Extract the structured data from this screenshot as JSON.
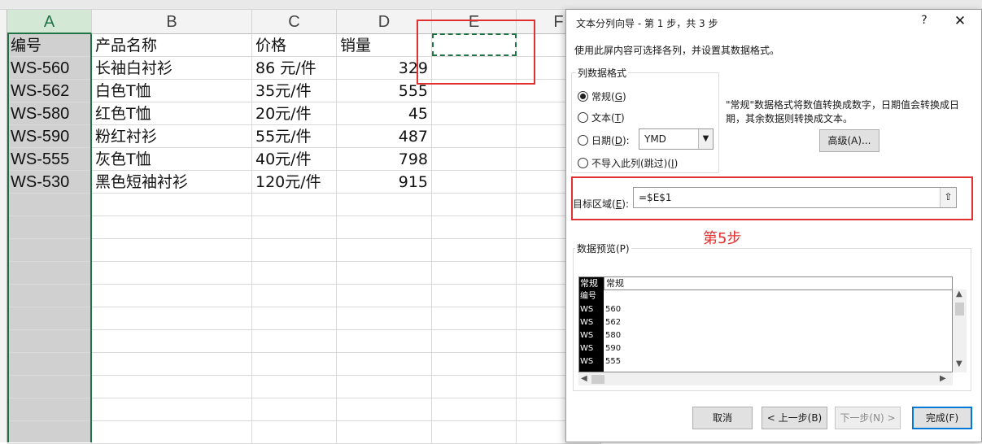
{
  "sheet": {
    "columns": [
      "A",
      "B",
      "C",
      "D",
      "E",
      "F"
    ],
    "rows": [
      [
        "编号",
        "产品名称",
        "价格",
        "销量"
      ],
      [
        "WS-560",
        "长袖白衬衫",
        "86 元/件",
        "329"
      ],
      [
        "WS-562",
        "白色T恤",
        "35元/件",
        "555"
      ],
      [
        "WS-580",
        "红色T恤",
        "20元/件",
        "45"
      ],
      [
        "WS-590",
        "粉红衬衫",
        "55元/件",
        "487"
      ],
      [
        "WS-555",
        "灰色T恤",
        "40元/件",
        "798"
      ],
      [
        "WS-530",
        "黑色短袖衬衫",
        "120元/件",
        "915"
      ]
    ],
    "selected_column": "A",
    "accent_color": "#217346",
    "annotation_color": "#e0302f"
  },
  "dialog": {
    "title": "文本分列向导 - 第 1 步，共 3 步",
    "help_label": "?",
    "close_label": "✕",
    "description": "使用此屏内容可选择各列，并设置其数据格式。",
    "column_format": {
      "group_label": "列数据格式",
      "options": [
        {
          "text": "常规(",
          "key": "G",
          "tail": ")",
          "checked": true
        },
        {
          "text": "文本(",
          "key": "T",
          "tail": ")",
          "checked": false
        },
        {
          "text": "日期(",
          "key": "D",
          "tail": "):",
          "checked": false
        },
        {
          "text": "不导入此列(跳过)(",
          "key": "I",
          "tail": ")",
          "checked": false
        }
      ],
      "date_format": "YMD",
      "info": "\"常规\"数据格式将数值转换成数字，日期值会转换成日期，其余数据则转换成文本。",
      "advanced_button": "高级(A)..."
    },
    "destination": {
      "label_text": "目标区域(",
      "label_key": "E",
      "label_tail": "):",
      "value": "=$E$1",
      "collapse_icon": "⇧"
    },
    "annotation": "第5步",
    "preview": {
      "label": "数据预览(P)",
      "headers": [
        "常规",
        "常规"
      ],
      "rows": [
        [
          "编号",
          ""
        ],
        [
          "WS",
          "560"
        ],
        [
          "WS",
          "562"
        ],
        [
          "WS",
          "580"
        ],
        [
          "WS",
          "590"
        ],
        [
          "WS",
          "555"
        ]
      ]
    },
    "buttons": {
      "cancel": "取消",
      "back": "< 上一步(B)",
      "next": "下一步(N) >",
      "finish": "完成(F)"
    }
  }
}
